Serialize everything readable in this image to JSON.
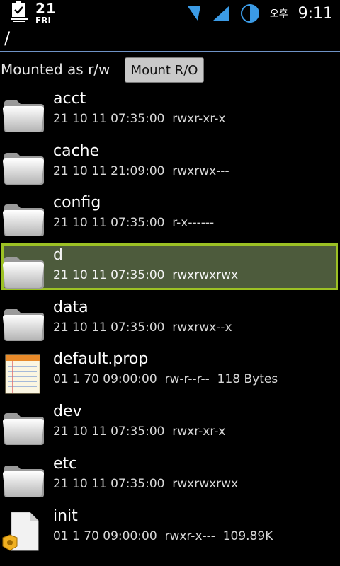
{
  "statusbar": {
    "date_day": "21",
    "date_weekday": "FRI",
    "ampm": "오후",
    "time": "9:11"
  },
  "path": "/",
  "mount": {
    "status": "Mounted as r/w",
    "button_label": "Mount R/O"
  },
  "files": [
    {
      "name": "acct",
      "date": "21 10 11 07:35:00",
      "perms": "rwxr-xr-x",
      "size": "",
      "type": "folder"
    },
    {
      "name": "cache",
      "date": "21 10 11 21:09:00",
      "perms": "rwxrwx---",
      "size": "",
      "type": "folder"
    },
    {
      "name": "config",
      "date": "21 10 11 07:35:00",
      "perms": "r-x------",
      "size": "",
      "type": "folder"
    },
    {
      "name": "d",
      "date": "21 10 11 07:35:00",
      "perms": "rwxrwxrwx",
      "size": "",
      "type": "folder"
    },
    {
      "name": "data",
      "date": "21 10 11 07:35:00",
      "perms": "rwxrwx--x",
      "size": "",
      "type": "folder"
    },
    {
      "name": "default.prop",
      "date": "01 1 70 09:00:00",
      "perms": "rw-r--r--",
      "size": "118 Bytes",
      "type": "text"
    },
    {
      "name": "dev",
      "date": "21 10 11 07:35:00",
      "perms": "rwxr-xr-x",
      "size": "",
      "type": "folder"
    },
    {
      "name": "etc",
      "date": "21 10 11 07:35:00",
      "perms": "rwxrwxrwx",
      "size": "",
      "type": "folder"
    },
    {
      "name": "init",
      "date": "01 1 70 09:00:00",
      "perms": "rwxr-x---",
      "size": "109.89K",
      "type": "binary"
    }
  ],
  "icons": {
    "folder": "folder-icon",
    "text": "text-file-icon",
    "binary": "executable-file-icon"
  },
  "colors": {
    "accent_line": "#6f93c6",
    "selection_border": "#9cc124"
  }
}
